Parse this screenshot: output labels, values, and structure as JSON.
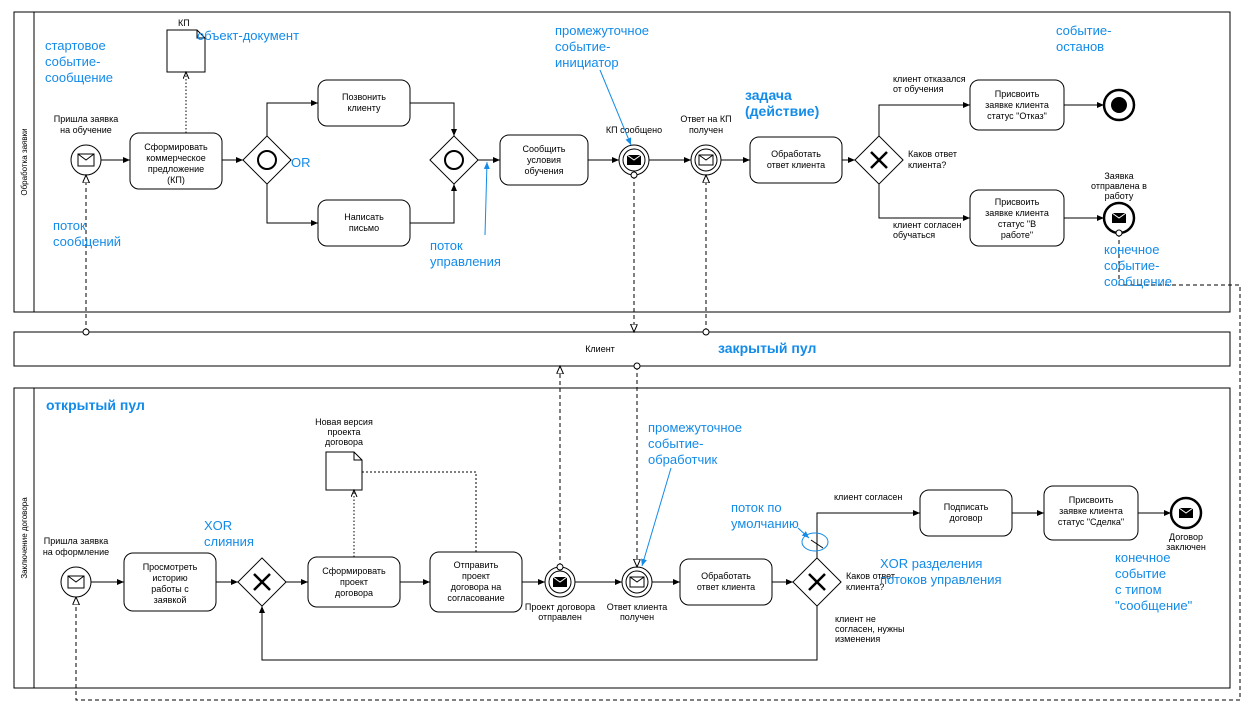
{
  "pools": {
    "p1": "Обработка заявки",
    "p2": "Клиент",
    "p3": "Заключение договора"
  },
  "annot": {
    "startMsg": "стартовое событие-сообщение",
    "objDoc": "объект-документ",
    "intermInit": "промежуточное событие-инициатор",
    "stopEvt": "событие-останов",
    "task": "задача (действие)",
    "msgFlow": "поток сообщений",
    "ctrlFlow": "поток управления",
    "or": "OR",
    "closedPool": "закрытый пул",
    "openPool": "открытый пул",
    "xorMerge": "XOR слияния",
    "intermHandler": "промежуточное событие-обработчик",
    "defaultFlow": "поток по умолчанию",
    "xorSplit": "XOR разделения потоков управления",
    "endMsgEvt": "конечное событие-сообщение",
    "endMsgType": "конечное событие с типом \"сообщение\""
  },
  "lane1": {
    "kp": "КП",
    "startLbl1": "Пришла заявка",
    "startLbl2": "на обучение",
    "t1a": "Сформировать",
    "t1b": "коммерческое",
    "t1c": "предложение",
    "t1d": "(КП)",
    "t2a": "Позвонить",
    "t2b": "клиенту",
    "t3a": "Написать",
    "t3b": "письмо",
    "t4a": "Сообщить",
    "t4b": "условия",
    "t4c": "обучения",
    "e1": "КП сообщено",
    "e2a": "Ответ на КП",
    "e2b": "получен",
    "t5a": "Обработать",
    "t5b": "ответ клиента",
    "q1a": "Каков ответ",
    "q1b": "клиента?",
    "c1a": "клиент отказался",
    "c1b": "от обучения",
    "c2a": "клиент согласен",
    "c2b": "обучаться",
    "t6a": "Присвоить",
    "t6b": "заявке клиента",
    "t6c": "статус \"Отказ\"",
    "t7a": "Присвоить",
    "t7b": "заявке клиента",
    "t7c": "статус \"В",
    "t7d": "работе\"",
    "end1a": "Заявка",
    "end1b": "отправлена в",
    "end1c": "работу"
  },
  "lane3": {
    "doc1": "Новая версия",
    "doc2": "проекта",
    "doc3": "договора",
    "s1": "Пришла заявка",
    "s2": "на оформление",
    "t1a": "Просмотреть",
    "t1b": "историю",
    "t1c": "работы с",
    "t1d": "заявкой",
    "t2a": "Сформировать",
    "t2b": "проект",
    "t2c": "договора",
    "t3a": "Отправить",
    "t3b": "проект",
    "t3c": "договора на",
    "t3d": "согласование",
    "e1a": "Проект договора",
    "e1b": "отправлен",
    "e2a": "Ответ клиента",
    "e2b": "получен",
    "t4a": "Обработать",
    "t4b": "ответ клиента",
    "q1a": "Каков ответ",
    "q1b": "клиента?",
    "c1": "клиент согласен",
    "c2a": "клиент не",
    "c2b": "согласен, нужны",
    "c2c": "изменения",
    "t5a": "Подписать",
    "t5b": "договор",
    "t6a": "Присвоить",
    "t6b": "заявке клиента",
    "t6c": "статус \"Сделка\"",
    "end1a": "Договор",
    "end1b": "заключен"
  }
}
